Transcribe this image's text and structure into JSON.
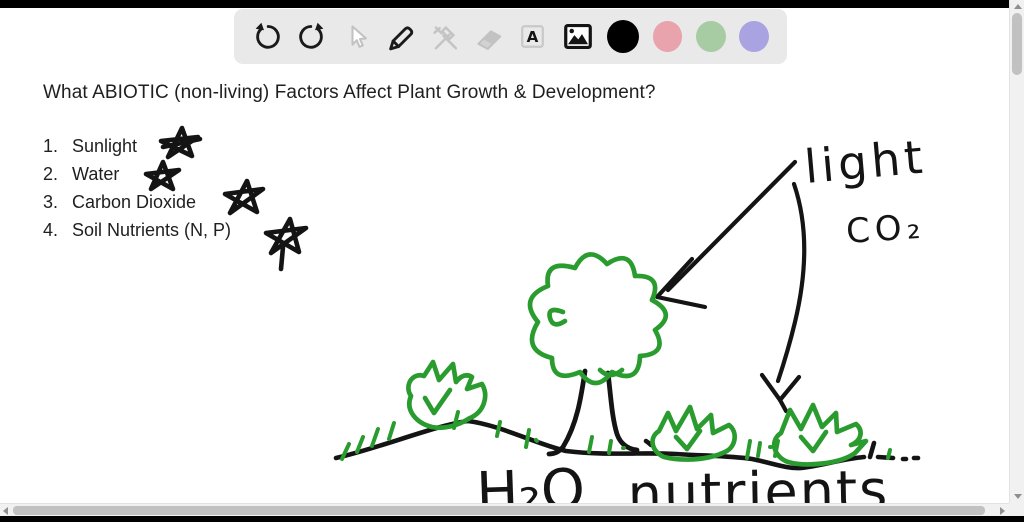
{
  "toolbar": {
    "tools": [
      {
        "id": "undo",
        "state": "enabled"
      },
      {
        "id": "redo",
        "state": "enabled"
      },
      {
        "id": "select",
        "state": "disabled"
      },
      {
        "id": "pen",
        "state": "active"
      },
      {
        "id": "shape-tools",
        "state": "disabled"
      },
      {
        "id": "eraser",
        "state": "disabled"
      },
      {
        "id": "text",
        "state": "disabled"
      },
      {
        "id": "insert-image",
        "state": "enabled"
      }
    ],
    "text_tool_glyph": "A",
    "colors": [
      {
        "name": "black",
        "hex": "#000000"
      },
      {
        "name": "pink",
        "hex": "#E8A3AC"
      },
      {
        "name": "green",
        "hex": "#A7CCA4"
      },
      {
        "name": "purple",
        "hex": "#A9A3E2"
      }
    ]
  },
  "board": {
    "title": "What ABIOTIC (non-living) Factors Affect Plant Growth & Development?",
    "list": [
      {
        "num": "1.",
        "label": "Sunlight"
      },
      {
        "num": "2.",
        "label": "Water"
      },
      {
        "num": "3.",
        "label": "Carbon Dioxide"
      },
      {
        "num": "4.",
        "label": "Soil Nutrients (N, P)"
      }
    ],
    "annotations": {
      "light": "light",
      "co2": "CO₂",
      "h2o": "H₂O",
      "nutrients": "nutrients"
    },
    "ink": {
      "black": "#141414",
      "green": "#2a9c2f"
    }
  }
}
